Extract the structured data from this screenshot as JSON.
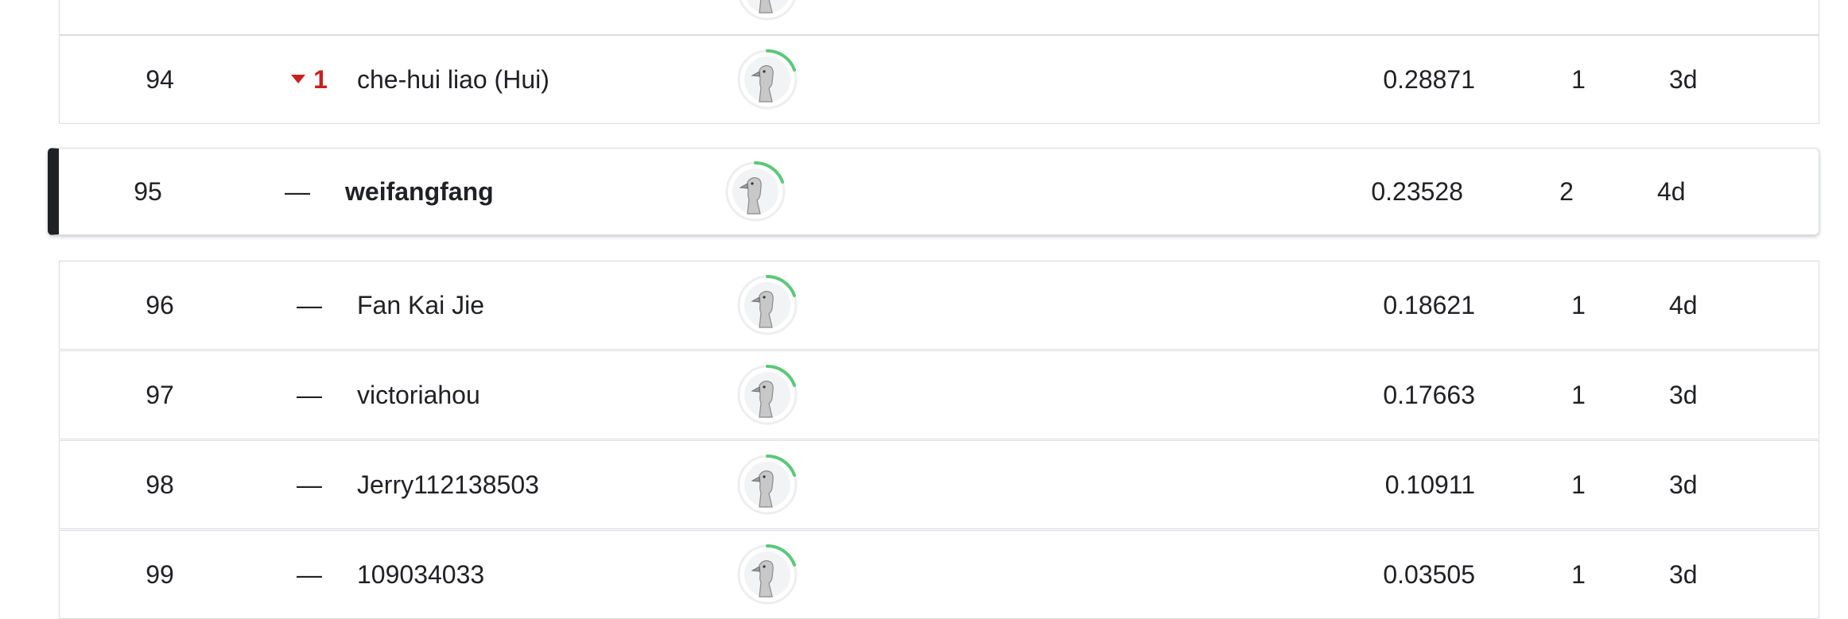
{
  "rows": [
    {
      "rank": "",
      "delta": "",
      "delta_dir": "none",
      "name": "",
      "score": "",
      "entries": "",
      "last": "",
      "current": false,
      "partial": true
    },
    {
      "rank": "94",
      "delta": "1",
      "delta_dir": "down",
      "name": "che-hui liao (Hui)",
      "score": "0.28871",
      "entries": "1",
      "last": "3d",
      "current": false
    },
    {
      "rank": "95",
      "delta": "—",
      "delta_dir": "none",
      "name": "weifangfang",
      "score": "0.23528",
      "entries": "2",
      "last": "4d",
      "current": true
    },
    {
      "rank": "96",
      "delta": "—",
      "delta_dir": "none",
      "name": "Fan Kai Jie",
      "score": "0.18621",
      "entries": "1",
      "last": "4d",
      "current": false
    },
    {
      "rank": "97",
      "delta": "—",
      "delta_dir": "none",
      "name": "victoriahou",
      "score": "0.17663",
      "entries": "1",
      "last": "3d",
      "current": false
    },
    {
      "rank": "98",
      "delta": "—",
      "delta_dir": "none",
      "name": "Jerry112138503",
      "score": "0.10911",
      "entries": "1",
      "last": "3d",
      "current": false
    },
    {
      "rank": "99",
      "delta": "—",
      "delta_dir": "none",
      "name": "109034033",
      "score": "0.03505",
      "entries": "1",
      "last": "3d",
      "current": false
    }
  ],
  "colors": {
    "delta_down": "#c5221f",
    "progress_ring": "#34a853",
    "current_marker": "#202124",
    "border": "#dadce0"
  },
  "icons": {
    "avatar": "goose-avatar-icon",
    "delta_down": "triangle-down-icon"
  }
}
